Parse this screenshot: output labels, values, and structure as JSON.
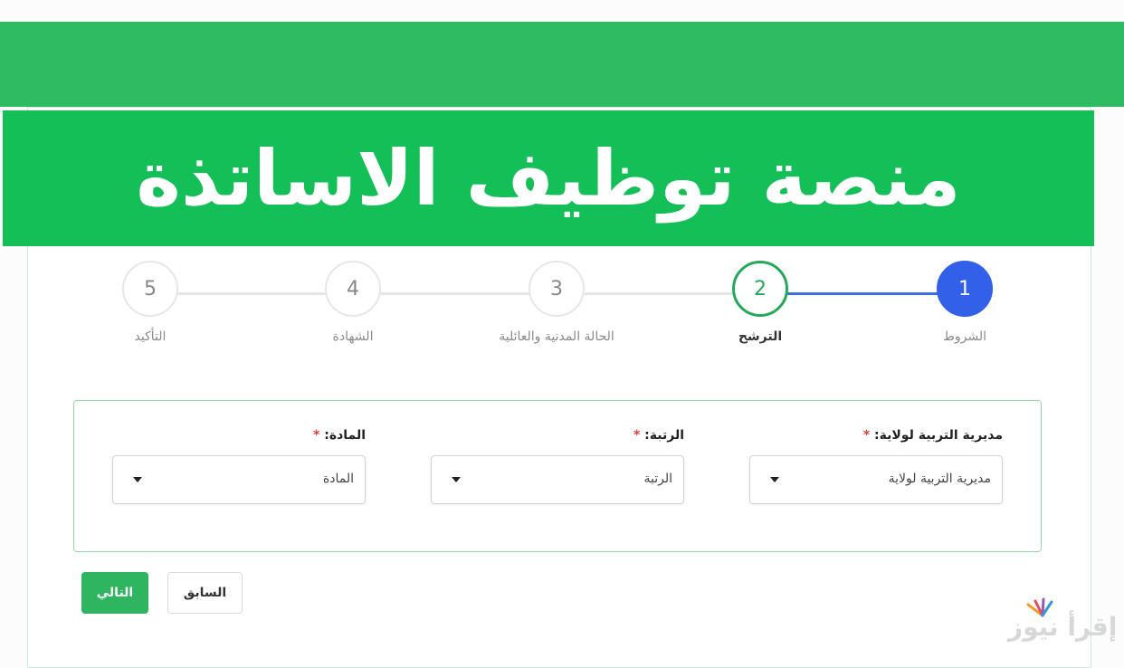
{
  "banner": {
    "title": "منصة توظيف الاساتذة"
  },
  "stepper": {
    "steps": [
      {
        "number": "1",
        "label": "الشروط",
        "state": "done"
      },
      {
        "number": "2",
        "label": "الترشح",
        "state": "current"
      },
      {
        "number": "3",
        "label": "الحالة المدنية والعائلية",
        "state": "pending"
      },
      {
        "number": "4",
        "label": "الشهادة",
        "state": "pending"
      },
      {
        "number": "5",
        "label": "التأكيد",
        "state": "pending"
      }
    ]
  },
  "form": {
    "fields": [
      {
        "label": "مديرية التربية لولاية:",
        "required_mark": "*",
        "value": "مديرية التربية لولاية"
      },
      {
        "label": "الرتبة:",
        "required_mark": "*",
        "value": "الرتبة"
      },
      {
        "label": "المادة:",
        "required_mark": "*",
        "value": "المادة"
      }
    ]
  },
  "buttons": {
    "next_label": "التالي",
    "prev_label": "السابق"
  },
  "watermark": {
    "text": "إقرأ نيوز"
  },
  "colors": {
    "brand_green": "#14bf58",
    "header_green": "#2fbb62",
    "step_done_blue": "#3260e8",
    "step_current_green": "#25a85a",
    "required_red": "#e04040"
  }
}
